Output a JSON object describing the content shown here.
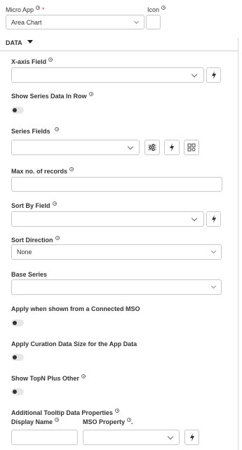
{
  "top": {
    "micro_app_label": "Micro App",
    "micro_app_value": "Area Chart",
    "icon_label": "Icon"
  },
  "section": {
    "title": "DATA"
  },
  "fields": {
    "x_axis": "X-axis Field",
    "show_series_in_row": "Show Series Data In Row",
    "series_fields": "Series Fields",
    "max_records": "Max no. of records",
    "sort_by": "Sort By Field",
    "sort_direction": "Sort Direction",
    "sort_direction_value": "None",
    "base_series": "Base Series",
    "apply_connected_mso": "Apply when shown from a Connected MSO",
    "apply_curation": "Apply Curation Data Size for the App Data",
    "show_topn": "Show TopN Plus Other",
    "additional_tooltip": "Additional Tooltip Data Properties",
    "display_name": "Display Name",
    "mso_property": "MSO Property"
  },
  "colors": {
    "border": "#c9c9c9",
    "toggle_knob": "#333333"
  },
  "icons": [
    "info-icon",
    "chevron-down-icon",
    "bolt-icon",
    "sliders-icon",
    "grid-settings-icon",
    "caret-down-icon"
  ]
}
